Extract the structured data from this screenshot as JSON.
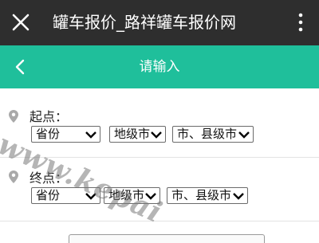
{
  "topbar": {
    "title": "罐车报价_路祥罐车报价网",
    "close_icon": "close-icon",
    "more_icon": "more-vertical-icon"
  },
  "header": {
    "title": "请输入",
    "back_icon": "chevron-left-icon",
    "accent_color": "#1fbf9b"
  },
  "origin": {
    "label": "起点：",
    "icon": "location-pin-icon",
    "province": "省份",
    "city": "地级市",
    "county": "市、县级市"
  },
  "destination": {
    "label": "终点：",
    "icon": "location-pin-icon",
    "province": "省份",
    "city": "地级市",
    "county": "市、县级市"
  },
  "watermark": {
    "text": "www.kepai"
  }
}
